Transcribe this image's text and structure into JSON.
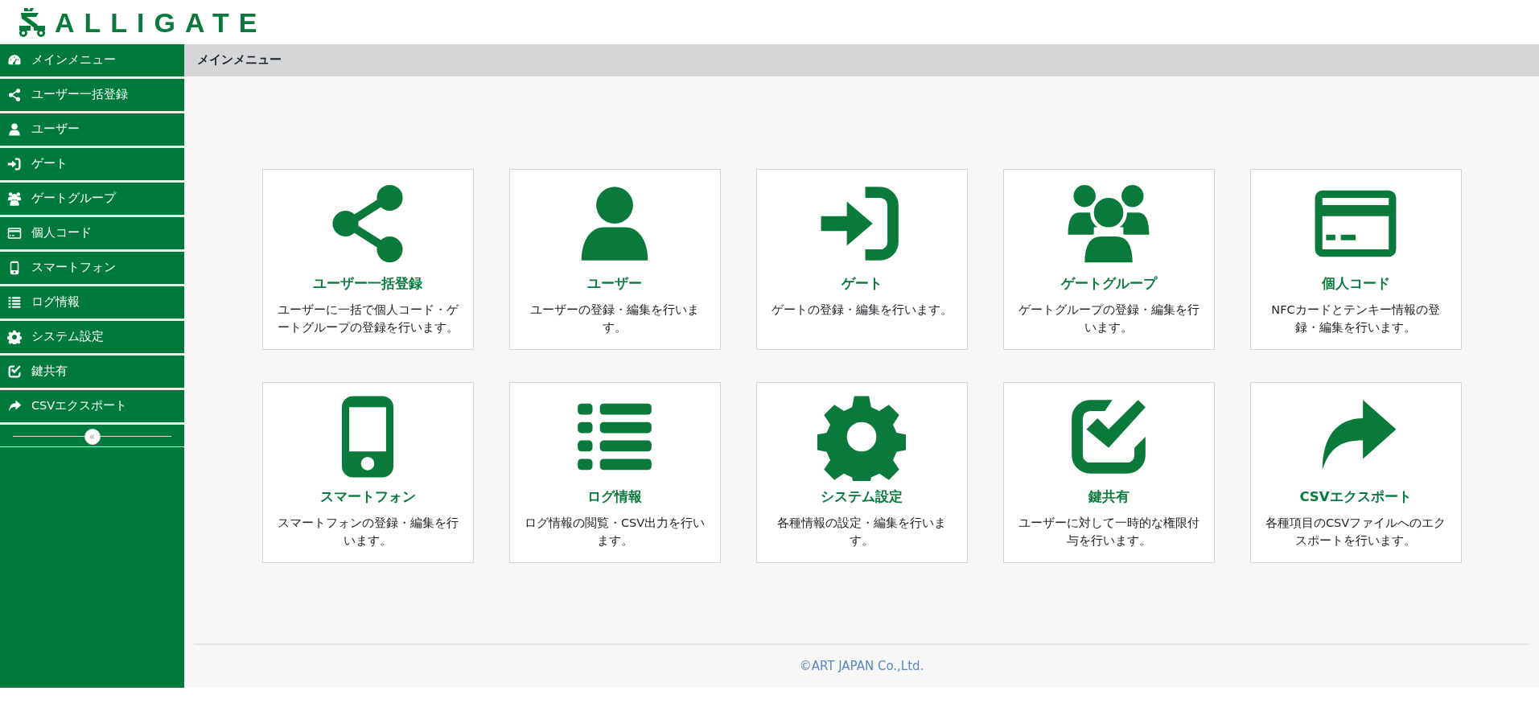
{
  "logo": {
    "text": "ALLIGATE"
  },
  "sidebar": {
    "items": [
      {
        "label": "メインメニュー"
      },
      {
        "label": "ユーザー一括登録"
      },
      {
        "label": "ユーザー"
      },
      {
        "label": "ゲート"
      },
      {
        "label": "ゲートグループ"
      },
      {
        "label": "個人コード"
      },
      {
        "label": "スマートフォン"
      },
      {
        "label": "ログ情報"
      },
      {
        "label": "システム設定"
      },
      {
        "label": "鍵共有"
      },
      {
        "label": "CSVエクスポート"
      }
    ],
    "collapse_toggle": "«"
  },
  "page_title": "メインメニュー",
  "cards": [
    {
      "title": "ユーザー一括登録",
      "description": "ユーザーに一括で個人コード・ゲートグループの登録を行います。"
    },
    {
      "title": "ユーザー",
      "description": "ユーザーの登録・編集を行います。"
    },
    {
      "title": "ゲート",
      "description": "ゲートの登録・編集を行います。"
    },
    {
      "title": "ゲートグループ",
      "description": "ゲートグループの登録・編集を行います。"
    },
    {
      "title": "個人コード",
      "description": "NFCカードとテンキー情報の登録・編集を行います。"
    },
    {
      "title": "スマートフォン",
      "description": "スマートフォンの登録・編集を行います。"
    },
    {
      "title": "ログ情報",
      "description": "ログ情報の閲覧・CSV出力を行います。"
    },
    {
      "title": "システム設定",
      "description": "各種情報の設定・編集を行います。"
    },
    {
      "title": "鍵共有",
      "description": "ユーザーに対して一時的な権限付与を行います。"
    },
    {
      "title": "CSVエクスポート",
      "description": "各種項目のCSVファイルへのエクスポートを行います。"
    }
  ],
  "footer": "©ART JAPAN Co.,Ltd."
}
